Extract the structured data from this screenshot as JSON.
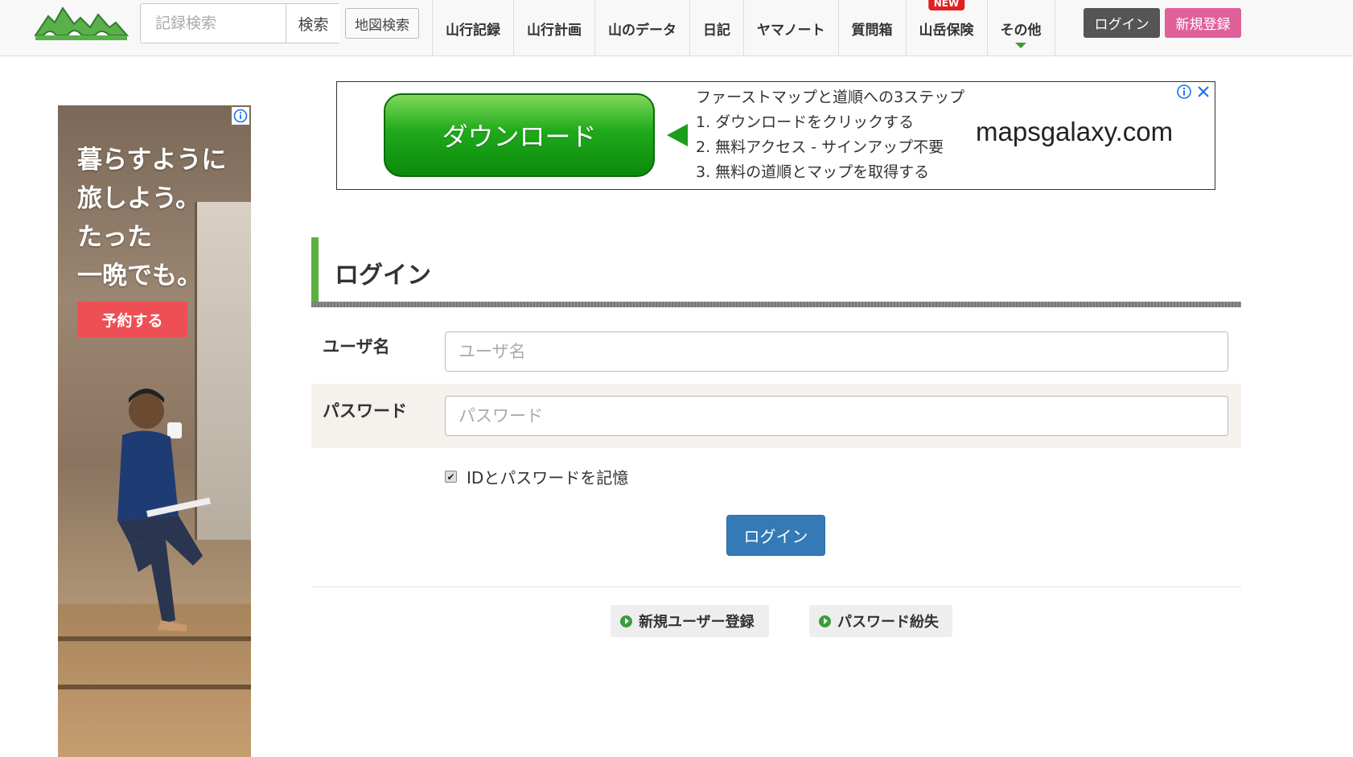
{
  "colors": {
    "brand_green": "#3a9d3a",
    "accent_pink": "#e0609a",
    "primary_blue": "#337ab7",
    "new_badge_red": "#e02020"
  },
  "header": {
    "logo_icon": "mountain-logo",
    "search": {
      "placeholder": "記録検索",
      "button": "検索"
    },
    "map_search": "地図検索",
    "nav": [
      {
        "label": "山行記録"
      },
      {
        "label": "山行計画"
      },
      {
        "label": "山のデータ"
      },
      {
        "label": "日記"
      },
      {
        "label": "ヤマノート"
      },
      {
        "label": "質問箱"
      },
      {
        "label": "山岳保険",
        "badge": "NEW"
      },
      {
        "label": "その他"
      }
    ],
    "login": "ログイン",
    "register": "新規登録"
  },
  "top_ad": {
    "button": "ダウンロード",
    "steps": [
      "ファーストマップと道順への3ステップ",
      "1. ダウンロードをクリックする",
      "2. 無料アクセス - サインアップ不要",
      "3. 無料の道順とマップを取得する"
    ],
    "domain": "mapsgalaxy.com"
  },
  "side_ad": {
    "copy": [
      "暮らすように",
      "旅しよう。",
      "たった",
      "一晩でも。"
    ],
    "button": "予約する"
  },
  "login": {
    "title": "ログイン",
    "username_label": "ユーザ名",
    "username_placeholder": "ユーザ名",
    "username_value": "",
    "password_label": "パスワード",
    "password_placeholder": "パスワード",
    "password_value": "",
    "remember_label": "IDとパスワードを記憶",
    "remember_checked": true,
    "submit": "ログイン",
    "links": {
      "register": "新規ユーザー登録",
      "lost_password": "パスワード紛失"
    }
  }
}
